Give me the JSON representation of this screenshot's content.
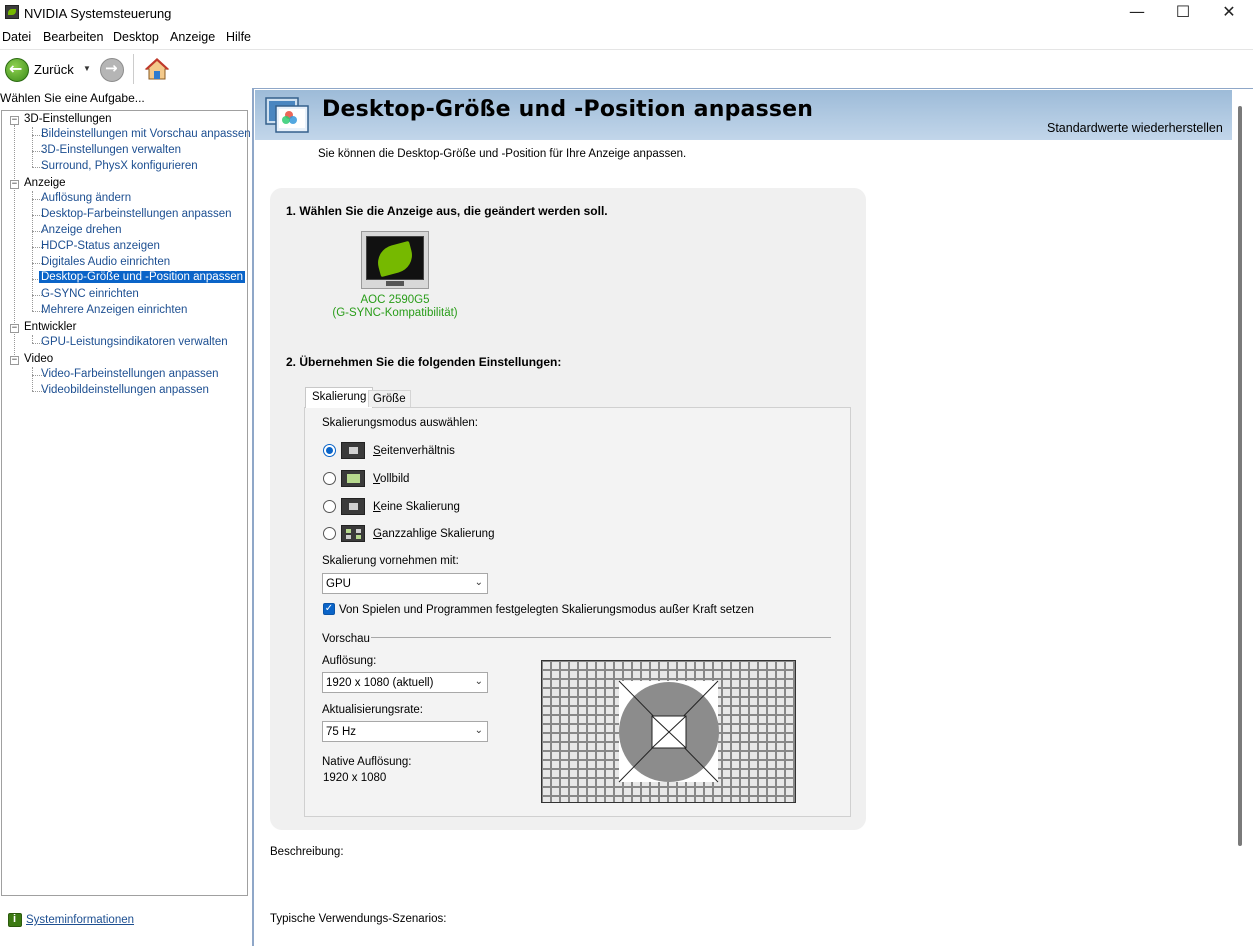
{
  "window": {
    "title": "NVIDIA Systemsteuerung",
    "minimize": "—",
    "maximize": "☐",
    "close": "✕"
  },
  "menu": [
    "Datei",
    "Bearbeiten",
    "Desktop",
    "Anzeige",
    "Hilfe"
  ],
  "toolbar": {
    "back_label": "Zurück",
    "back_dropdown": "▼"
  },
  "sidebar": {
    "header": "Wählen Sie eine Aufgabe...",
    "categories": [
      {
        "label": "3D-Einstellungen",
        "expander": "−",
        "items": [
          "Bildeinstellungen mit Vorschau anpassen",
          "3D-Einstellungen verwalten",
          "Surround, PhysX konfigurieren"
        ]
      },
      {
        "label": "Anzeige",
        "expander": "−",
        "items": [
          "Auflösung ändern",
          "Desktop-Farbeinstellungen anpassen",
          "Anzeige drehen",
          "HDCP-Status anzeigen",
          "Digitales Audio einrichten",
          "Desktop-Größe und -Position anpassen",
          "G-SYNC einrichten",
          "Mehrere Anzeigen einrichten"
        ]
      },
      {
        "label": "Entwickler",
        "expander": "−",
        "items": [
          "GPU-Leistungsindikatoren verwalten"
        ]
      },
      {
        "label": "Video",
        "expander": "−",
        "items": [
          "Video-Farbeinstellungen anpassen",
          "Videobildeinstellungen anpassen"
        ]
      }
    ],
    "selected_item": "Desktop-Größe und -Position anpassen",
    "system_info": "Systeminformationen"
  },
  "main": {
    "title": "Desktop-Größe und -Position anpassen",
    "restore_defaults": "Standardwerte wiederherstellen",
    "subtitle": "Sie können die Desktop-Größe und -Position für Ihre Anzeige anpassen.",
    "step1": "1. Wählen Sie die Anzeige aus, die geändert werden soll.",
    "display_name": "AOC 2590G5",
    "display_sub": "(G-SYNC-Kompatibilität)",
    "step2": "2. Übernehmen Sie die folgenden Einstellungen:",
    "tabs": [
      "Skalierung",
      "Größe"
    ],
    "scaling_mode_label": "Skalierungsmodus auswählen:",
    "scaling_modes": [
      {
        "accel": "S",
        "rest": "eitenverhältnis",
        "checked": true
      },
      {
        "accel": "V",
        "rest": "ollbild",
        "checked": false
      },
      {
        "accel": "K",
        "rest": "eine Skalierung",
        "checked": false
      },
      {
        "accel": "G",
        "rest": "anzzahlige Skalierung",
        "checked": false
      }
    ],
    "perform_scaling_label": "Skalierung vornehmen mit:",
    "perform_scaling_value": "GPU",
    "override_label": "Von Spielen und Programmen festgelegten Skalierungsmodus außer Kraft setzen",
    "override_checked": true,
    "preview_label": "Vorschau",
    "resolution_label": "Auflösung:",
    "resolution_value": "1920 x 1080 (aktuell)",
    "refresh_label": "Aktualisierungsrate:",
    "refresh_value": "75 Hz",
    "native_label": "Native Auflösung:",
    "native_value": "1920 x 1080",
    "description_label": "Beschreibung:",
    "usage_label": "Typische Verwendungs-Szenarios:"
  },
  "colors": {
    "accent_green": "#76b900",
    "link_blue": "#1d4f91",
    "selection_blue": "#0a64c8",
    "display_green": "#2a9d1a",
    "header_band": "#9dbbd8"
  },
  "icons": {
    "app": "nvidia-logo-icon",
    "back": "back-arrow-icon",
    "forward": "forward-arrow-icon",
    "home": "home-icon",
    "header": "display-settings-icon",
    "sysinfo": "info-icon"
  }
}
